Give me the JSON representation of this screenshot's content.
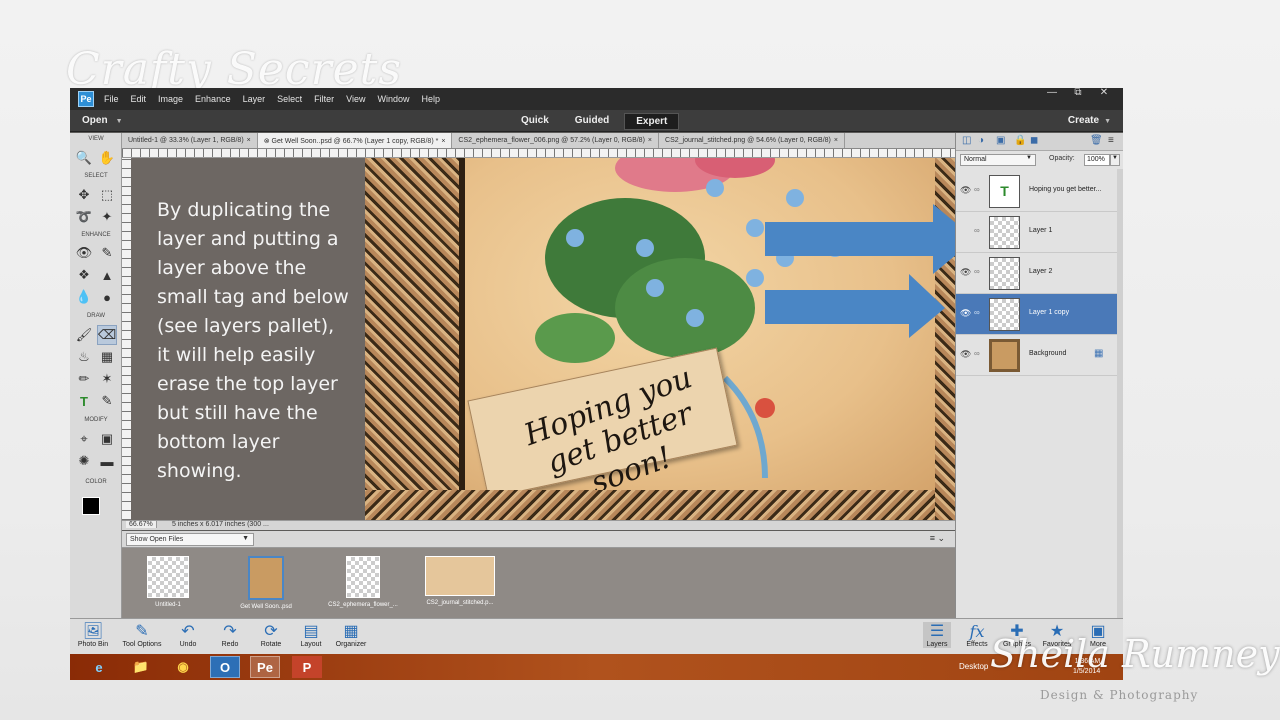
{
  "watermark": {
    "top": "Crafty Secrets",
    "signature": "Sheila Rumney",
    "signature_sub": "Design & Photography"
  },
  "app": {
    "menu": [
      "File",
      "Edit",
      "Image",
      "Enhance",
      "Layer",
      "Select",
      "Filter",
      "View",
      "Window",
      "Help"
    ],
    "open_label": "Open",
    "modes": [
      "Quick",
      "Guided",
      "Expert"
    ],
    "active_mode": "Expert",
    "create_label": "Create"
  },
  "toolbox": {
    "sections": [
      "VIEW",
      "SELECT",
      "ENHANCE",
      "DRAW",
      "MODIFY",
      "COLOR"
    ]
  },
  "tabs": [
    {
      "label": "Untitled-1 @ 33.3% (Layer 1, RGB/8)",
      "close": "×"
    },
    {
      "label": "⊗ Get Well Soon..psd @ 66.7% (Layer 1 copy, RGB/8) *",
      "close": "×"
    },
    {
      "label": "CS2_ephemera_flower_006.png @ 57.2% (Layer 0, RGB/8)",
      "close": "×"
    },
    {
      "label": "CS2_journal_stitched.png @ 54.6% (Layer 0, RGB/8)",
      "close": "×"
    }
  ],
  "canvas": {
    "note": "By duplicating the layer and putting a layer above the small tag and below (see layers pallet), it will help easily erase the top layer but still have the bottom layer showing.",
    "tag_text_line1": "Hoping you",
    "tag_text_line2": "get better soon!",
    "arrow_color": "#4a86c5"
  },
  "status": {
    "zoom": "66.67%",
    "info": "5 inches x 6.017 inches (300 ..."
  },
  "photobin": {
    "dropdown": "Show Open Files",
    "items": [
      {
        "caption": "Untitled-1"
      },
      {
        "caption": "Get Well Soon..psd"
      },
      {
        "caption": "CS2_ephemera_flower_..."
      },
      {
        "caption": "CS2_journal_stitched.p..."
      }
    ]
  },
  "layers": {
    "blend_mode": "Normal",
    "opacity_label": "Opacity:",
    "opacity": "100%",
    "items": [
      {
        "name": "Hoping you get better...",
        "kind": "text"
      },
      {
        "name": "Layer 1",
        "kind": "image"
      },
      {
        "name": "Layer 2",
        "kind": "image"
      },
      {
        "name": "Layer 1 copy",
        "kind": "image",
        "selected": true
      },
      {
        "name": "Background",
        "kind": "background"
      }
    ],
    "selected_color": "#4a79b8"
  },
  "taskbar": {
    "left": [
      "Photo Bin",
      "Tool Options",
      "Undo",
      "Redo",
      "Rotate",
      "Layout",
      "Organizer"
    ],
    "right": [
      "Layers",
      "Effects",
      "Graphics",
      "Favorites",
      "More"
    ]
  },
  "windows": {
    "desktop": "Desktop",
    "time": "1:36 AM",
    "date": "1/5/2014"
  }
}
